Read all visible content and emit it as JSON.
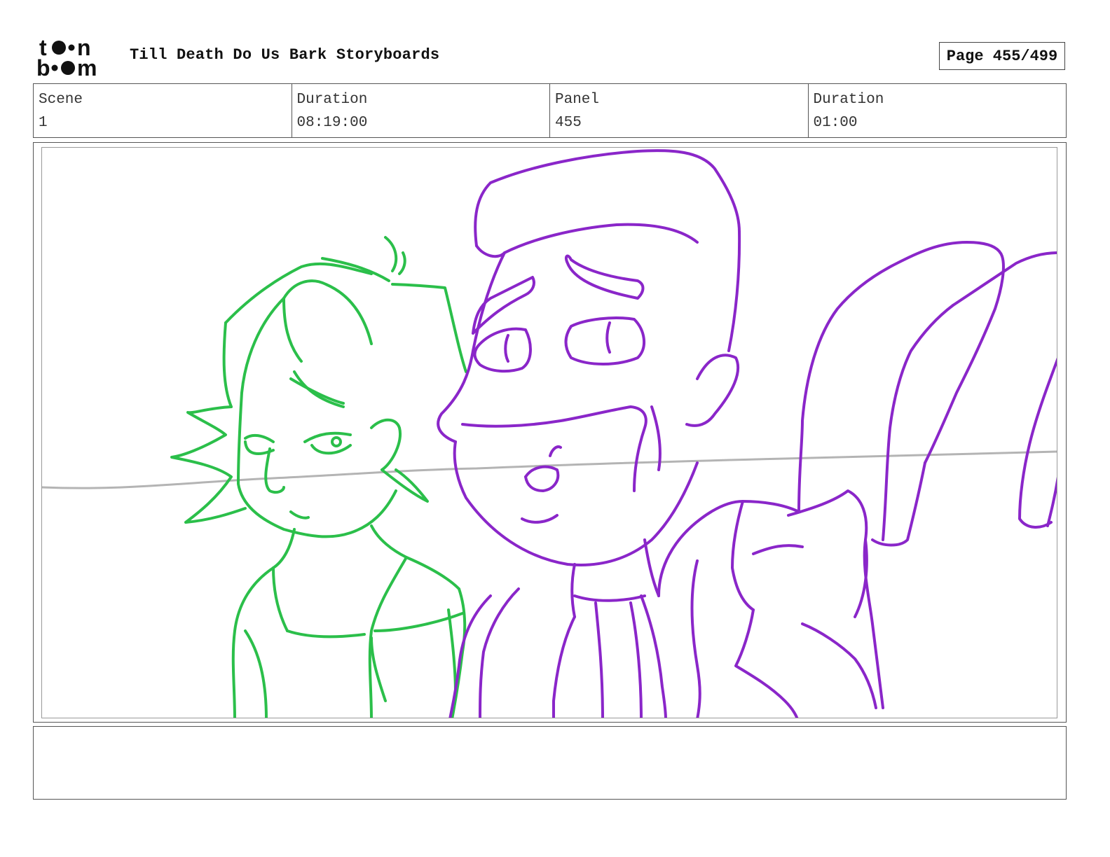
{
  "header": {
    "logo_text": "toon boom",
    "title": "Till Death Do Us Bark Storyboards",
    "page_label": "Page",
    "page_value": "455/499"
  },
  "info": {
    "scene_label": "Scene",
    "scene_value": "1",
    "duration_label": "Duration",
    "duration_value": "08:19:00",
    "panel_label": "Panel",
    "panel_value": "455",
    "panel_duration_label": "Duration",
    "panel_duration_value": "01:00"
  },
  "notes": {
    "text": ""
  },
  "colors": {
    "sketch_green": "#2bbf4a",
    "sketch_purple": "#8a26c9",
    "horizon_gray": "#b4b4b4"
  }
}
